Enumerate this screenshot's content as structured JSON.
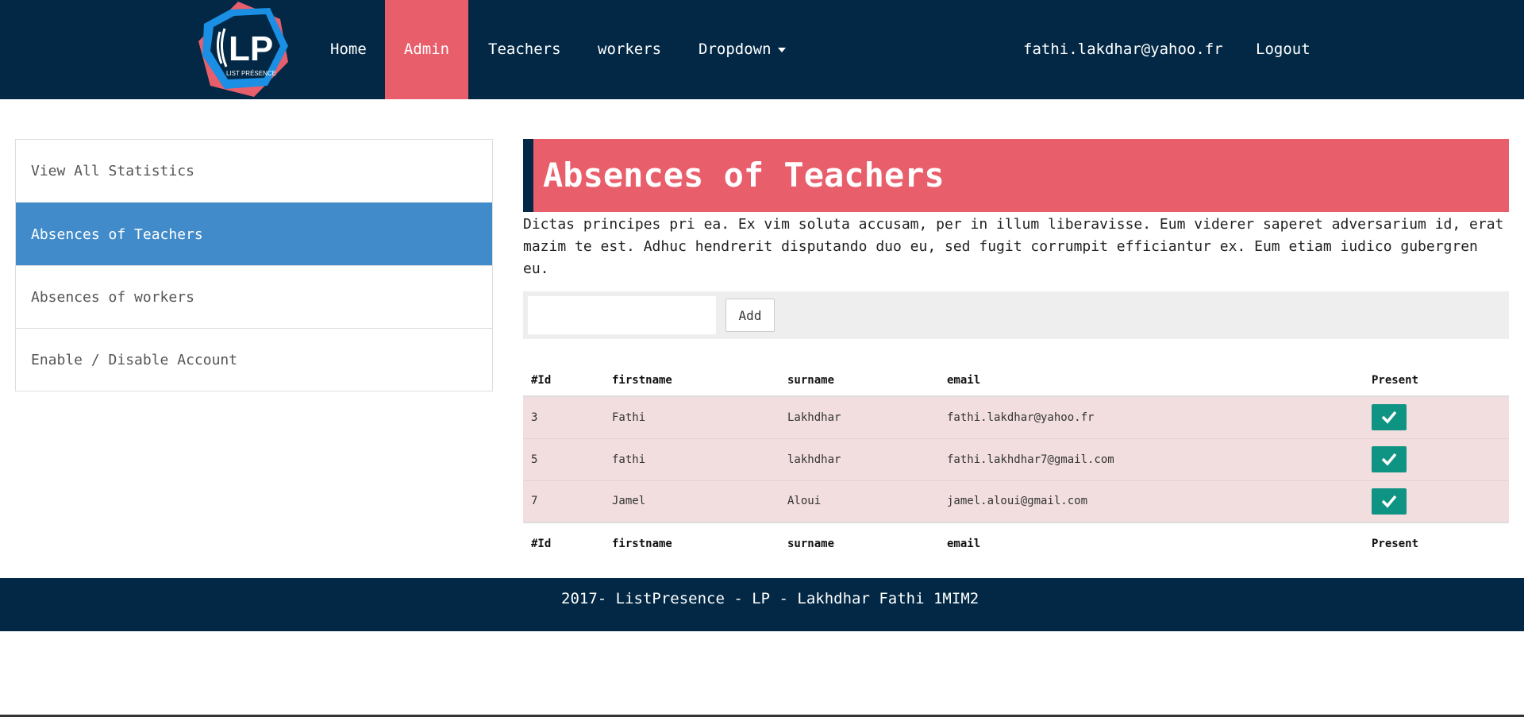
{
  "nav": {
    "logo_text": "LP",
    "logo_subtext": "LIST PRÉSENCE",
    "home": "Home",
    "admin": "Admin",
    "teachers": "Teachers",
    "workers": "workers",
    "dropdown": "Dropdown",
    "user_email": "fathi.lakdhar@yahoo.fr",
    "logout": "Logout"
  },
  "sidebar": {
    "items": [
      {
        "label": "View All Statistics"
      },
      {
        "label": "Absences of Teachers"
      },
      {
        "label": "Absences of workers"
      },
      {
        "label": "Enable / Disable Account"
      }
    ]
  },
  "main": {
    "title": "Absences of Teachers",
    "description": "Dictas principes pri ea. Ex vim soluta accusam, per in illum liberavisse. Eum viderer saperet adversarium id, erat mazim te est. Adhuc hendrerit disputando duo eu, sed fugit corrumpit efficiantur ex. Eum etiam iudico gubergren eu.",
    "add_input_value": "",
    "add_button": "Add"
  },
  "table": {
    "columns": [
      "#Id",
      "firstname",
      "surname",
      "email",
      "Present"
    ],
    "rows": [
      {
        "id": "3",
        "firstname": "Fathi",
        "surname": "Lakhdhar",
        "email": "fathi.lakdhar@yahoo.fr",
        "present": true
      },
      {
        "id": "5",
        "firstname": "fathi",
        "surname": "lakhdhar",
        "email": "fathi.lakhdhar7@gmail.com",
        "present": true
      },
      {
        "id": "7",
        "firstname": "Jamel",
        "surname": "Aloui",
        "email": "jamel.aloui@gmail.com",
        "present": true
      }
    ]
  },
  "footer": {
    "text": "2017- ListPresence - LP - Lakhdhar Fathi 1MIM2"
  },
  "colors": {
    "navbar": "#022845",
    "accent": "#e85e6b",
    "sidebar_active": "#428bca",
    "row_bg": "#f2dede",
    "check": "#0f9484"
  }
}
